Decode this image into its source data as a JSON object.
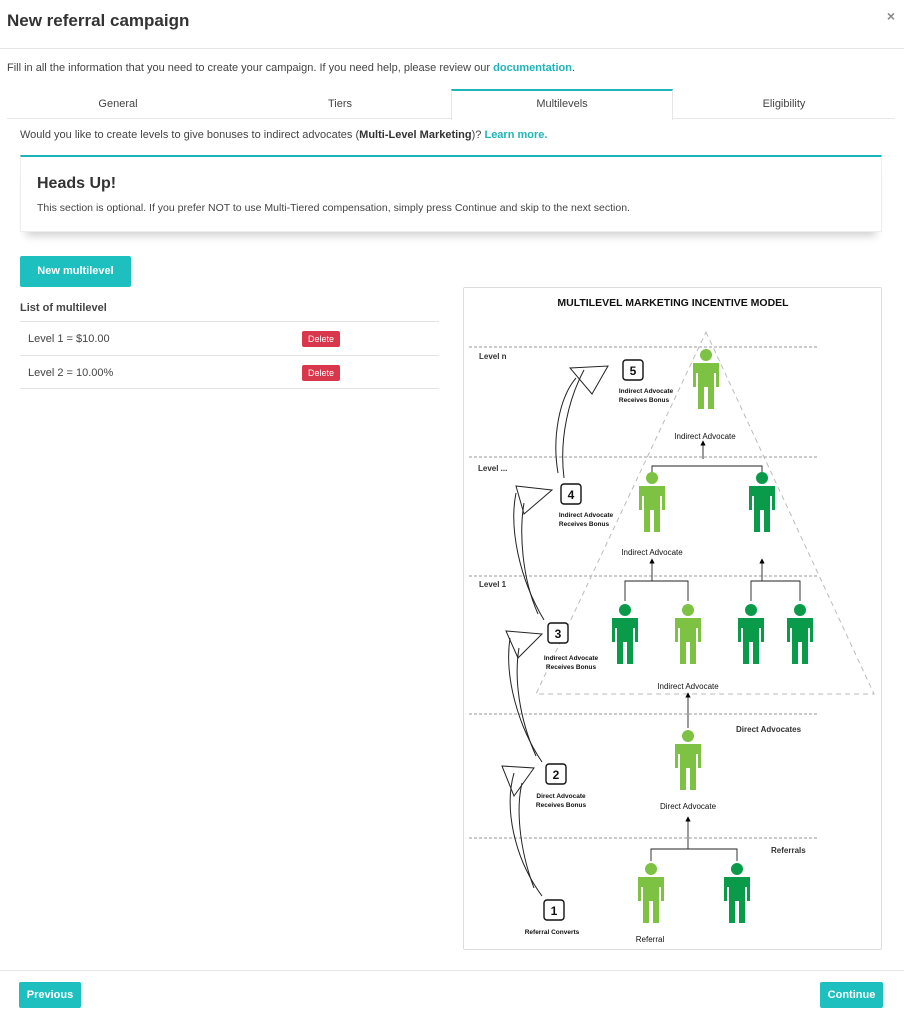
{
  "modal": {
    "title": "New referral campaign",
    "close": "×"
  },
  "intro": {
    "text": "Fill in all the information that you need to create your campaign. If you need help, please review our ",
    "link": "documentation",
    "suffix": "."
  },
  "tabs": [
    {
      "label": "General",
      "active": false
    },
    {
      "label": "Tiers",
      "active": false
    },
    {
      "label": "Multilevels",
      "active": true
    },
    {
      "label": "Eligibility",
      "active": false
    }
  ],
  "question": {
    "prefix": "Would you like to create levels to give bonuses to indirect advocates (",
    "bold": "Multi-Level Marketing",
    "suffix": ")? ",
    "link": "Learn more."
  },
  "alert": {
    "title": "Heads Up!",
    "text": "This section is optional. If you prefer NOT to use Multi-Tiered compensation, simply press Continue and skip to the next section."
  },
  "new_button": "New multilevel",
  "list": {
    "title": "List of multilevel",
    "items": [
      {
        "label": "Level 1 = $10.00",
        "delete": "Delete"
      },
      {
        "label": "Level 2 = 10.00%",
        "delete": "Delete"
      }
    ]
  },
  "diagram": {
    "title": "MULTILEVEL MARKETING INCENTIVE MODEL",
    "levels": [
      "Level n",
      "Level ...",
      "Level 1",
      "Direct Advocates",
      "Referrals"
    ],
    "steps": [
      {
        "num": "1",
        "line1": "Referral Converts",
        "line2": ""
      },
      {
        "num": "2",
        "line1": "Direct Advocate",
        "line2": "Receives Bonus"
      },
      {
        "num": "3",
        "line1": "Indirect Advocate",
        "line2": "Receives Bonus"
      },
      {
        "num": "4",
        "line1": "Indirect Advocate",
        "line2": "Receives Bonus"
      },
      {
        "num": "5",
        "line1": "Indirect Advocate",
        "line2": "Receives Bonus"
      }
    ],
    "person_labels": {
      "referral": "Referral",
      "direct": "Direct Advocate",
      "indirect_1": "Indirect Advocate",
      "indirect_2": "Indirect Advocate",
      "indirect_n": "Indirect Advocate"
    },
    "colors": {
      "light_green": "#7dc242",
      "dark_green": "#0a9b4a",
      "accent": "#1ebfbf",
      "danger": "#d9374b"
    }
  },
  "footer": {
    "previous": "Previous",
    "continue": "Continue"
  }
}
